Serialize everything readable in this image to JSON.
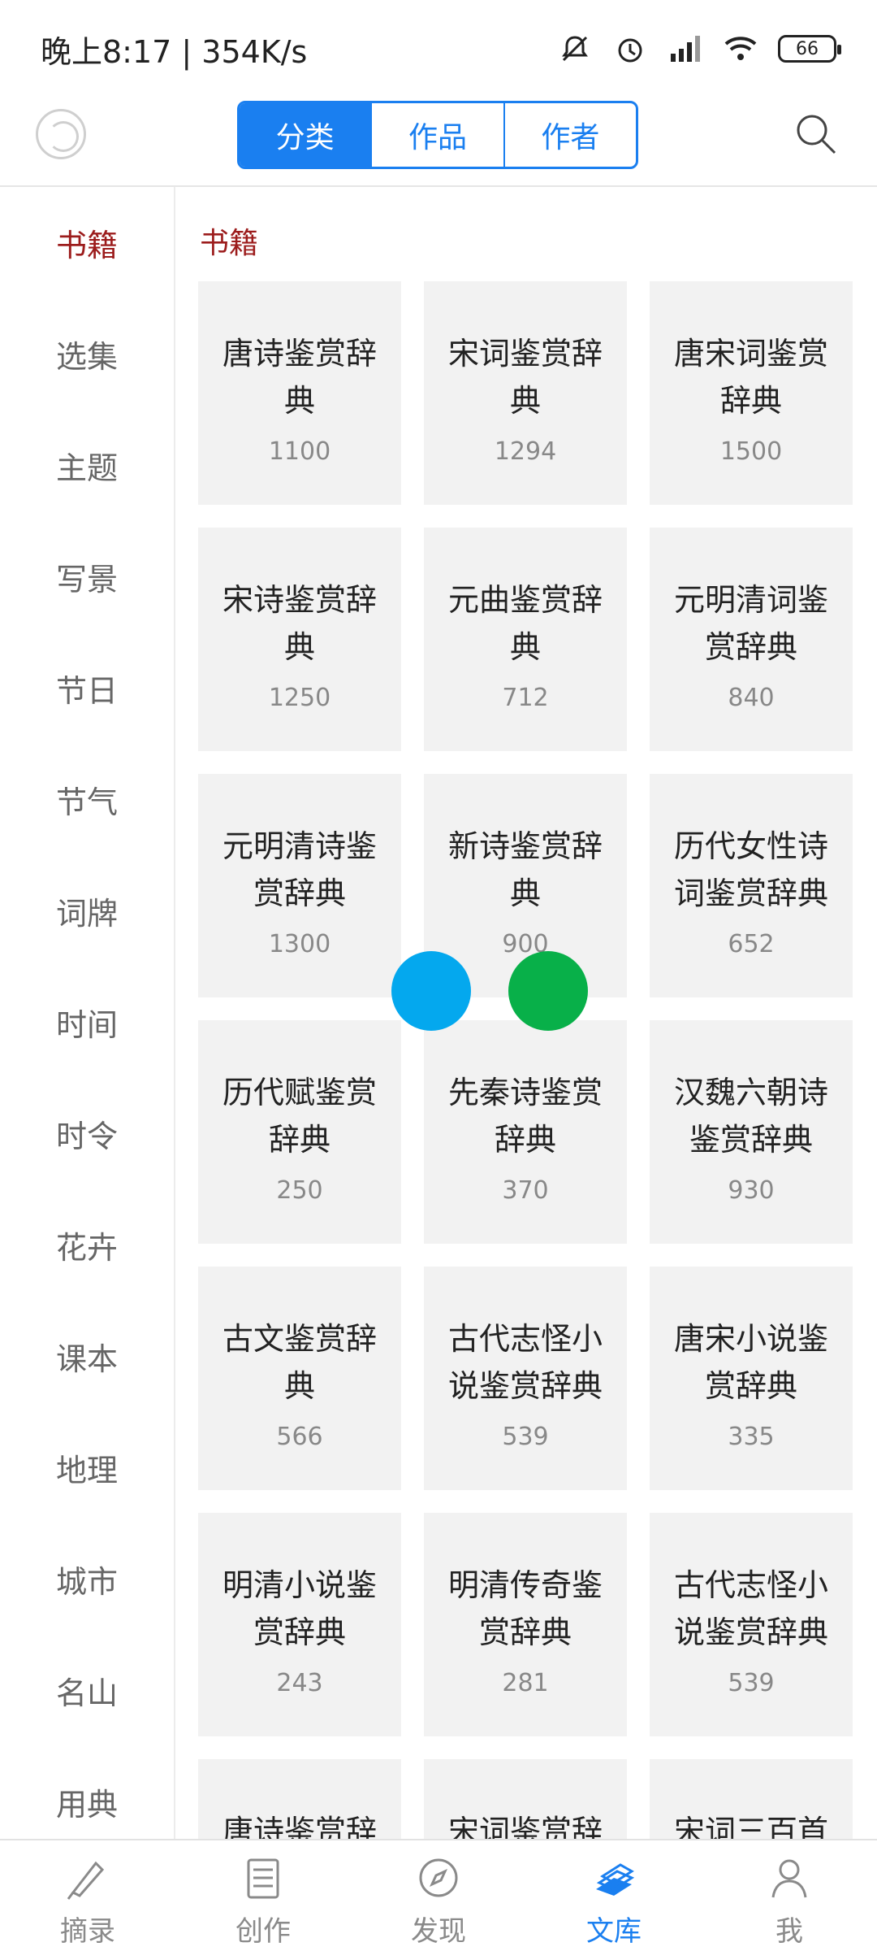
{
  "status_bar": {
    "time": "晚上8:17 | 354K/s",
    "battery": "66"
  },
  "top_bar": {
    "tabs": [
      {
        "label": "分类"
      },
      {
        "label": "作品"
      },
      {
        "label": "作者"
      }
    ]
  },
  "sidebar": {
    "items": [
      {
        "label": "书籍"
      },
      {
        "label": "选集"
      },
      {
        "label": "主题"
      },
      {
        "label": "写景"
      },
      {
        "label": "节日"
      },
      {
        "label": "节气"
      },
      {
        "label": "词牌"
      },
      {
        "label": "时间"
      },
      {
        "label": "时令"
      },
      {
        "label": "花卉"
      },
      {
        "label": "课本"
      },
      {
        "label": "地理"
      },
      {
        "label": "城市"
      },
      {
        "label": "名山"
      },
      {
        "label": "用典"
      }
    ]
  },
  "content": {
    "section_title": "书籍",
    "cards": [
      {
        "title": "唐诗鉴赏辞典",
        "count": "1100"
      },
      {
        "title": "宋词鉴赏辞典",
        "count": "1294"
      },
      {
        "title": "唐宋词鉴赏辞典",
        "count": "1500"
      },
      {
        "title": "宋诗鉴赏辞典",
        "count": "1250"
      },
      {
        "title": "元曲鉴赏辞典",
        "count": "712"
      },
      {
        "title": "元明清词鉴赏辞典",
        "count": "840"
      },
      {
        "title": "元明清诗鉴赏辞典",
        "count": "1300"
      },
      {
        "title": "新诗鉴赏辞典",
        "count": "900"
      },
      {
        "title": "历代女性诗词鉴赏辞典",
        "count": "652"
      },
      {
        "title": "历代赋鉴赏辞典",
        "count": "250"
      },
      {
        "title": "先秦诗鉴赏辞典",
        "count": "370"
      },
      {
        "title": "汉魏六朝诗鉴赏辞典",
        "count": "930"
      },
      {
        "title": "古文鉴赏辞典",
        "count": "566"
      },
      {
        "title": "古代志怪小说鉴赏辞典",
        "count": "539"
      },
      {
        "title": "唐宋小说鉴赏辞典",
        "count": "335"
      },
      {
        "title": "明清小说鉴赏辞典",
        "count": "243"
      },
      {
        "title": "明清传奇鉴赏辞典",
        "count": "281"
      },
      {
        "title": "古代志怪小说鉴赏辞典",
        "count": "539"
      },
      {
        "title": "唐诗鉴赏辞",
        "count": ""
      },
      {
        "title": "宋词鉴赏辞",
        "count": ""
      },
      {
        "title": "宋词三百首",
        "count": ""
      }
    ]
  },
  "bottom_nav": {
    "items": [
      {
        "label": "摘录"
      },
      {
        "label": "创作"
      },
      {
        "label": "发现"
      },
      {
        "label": "文库"
      },
      {
        "label": "我"
      }
    ]
  },
  "colors": {
    "accent_blue": "#1a7ff0",
    "accent_red": "#9c1c1c",
    "card_bg": "#f2f2f2",
    "dot_blue": "#04a8ee",
    "dot_green": "#08b049"
  }
}
